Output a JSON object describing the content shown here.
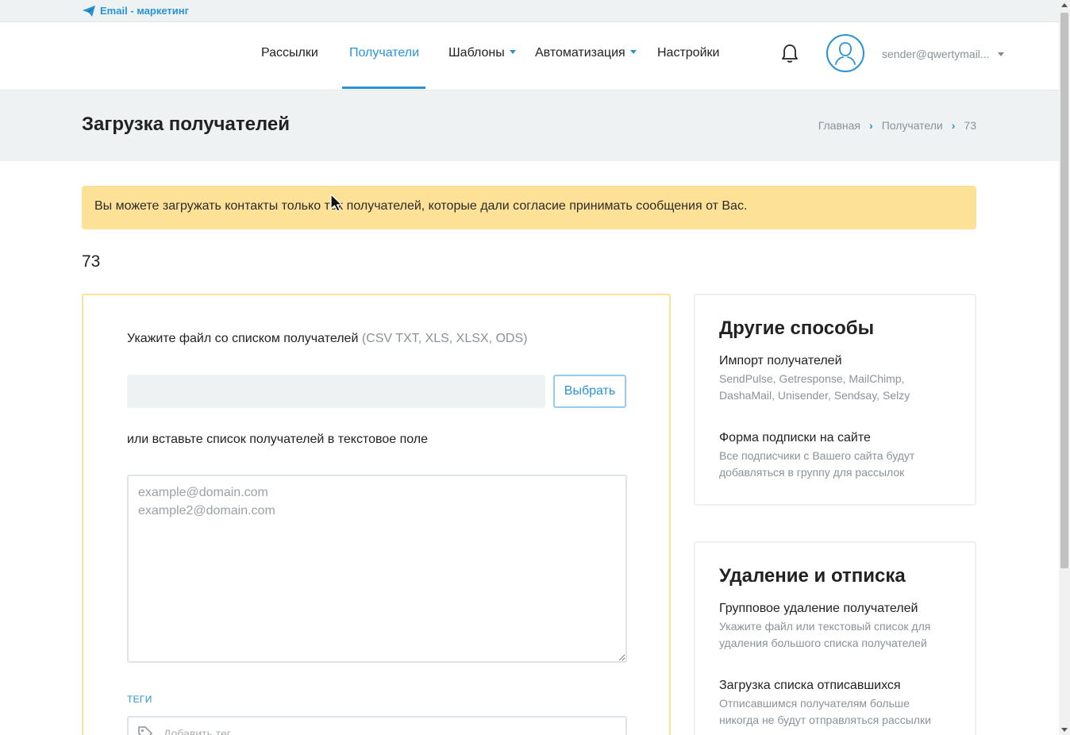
{
  "brand": {
    "label": "Email - маркетинг",
    "icon": "paper-plane-icon",
    "color": "#2a93d5"
  },
  "nav": {
    "items": [
      {
        "label": "Рассылки",
        "active": false,
        "dropdown": false
      },
      {
        "label": "Получатели",
        "active": true,
        "dropdown": false
      },
      {
        "label": "Шаблоны",
        "active": false,
        "dropdown": true
      },
      {
        "label": "Автоматизация",
        "active": false,
        "dropdown": true
      },
      {
        "label": "Настройки",
        "active": false,
        "dropdown": false
      }
    ],
    "user_email": "sender@qwertymail...",
    "accent_color": "#2a93d5"
  },
  "header": {
    "title": "Загрузка получателей",
    "breadcrumb": [
      "Главная",
      "Получатели",
      "73"
    ]
  },
  "alert": {
    "text": "Вы можете загружать контакты только тех получателей, которые дали согласие принимать сообщения от Вас.",
    "color": "#fce196"
  },
  "list_id": "73",
  "upload": {
    "file_label": "Укажите файл со списком получателей",
    "file_formats": "(CSV TXT, XLS, XLSX, ODS)",
    "choose_button": "Выбрать",
    "or_label": "или вставьте список получателей в текстовое поле",
    "textarea_placeholder": "example@domain.com\nexample2@domain.com",
    "tags_label": "ТЕГИ",
    "tags_placeholder": "Добавить тег"
  },
  "other_methods": {
    "title": "Другие способы",
    "items": [
      {
        "title": "Импорт получателей",
        "desc": "SendPulse, Getresponse, MailChimp, DashaMail, Unisender, Sendsay, Selzy"
      },
      {
        "title": "Форма подписки на сайте",
        "desc": "Все подписчики с Вашего сайта будут добавляться в группу для рассылок"
      }
    ]
  },
  "removal": {
    "title": "Удаление и отписка",
    "items": [
      {
        "title": "Групповое удаление получателей",
        "desc": "Укажите файл или текстовый список для удаления большого списка получателей"
      },
      {
        "title": "Загрузка списка отписавшихся",
        "desc": "Отписавшимся получателям больше никогда не будут отправляться рассылки"
      }
    ]
  }
}
